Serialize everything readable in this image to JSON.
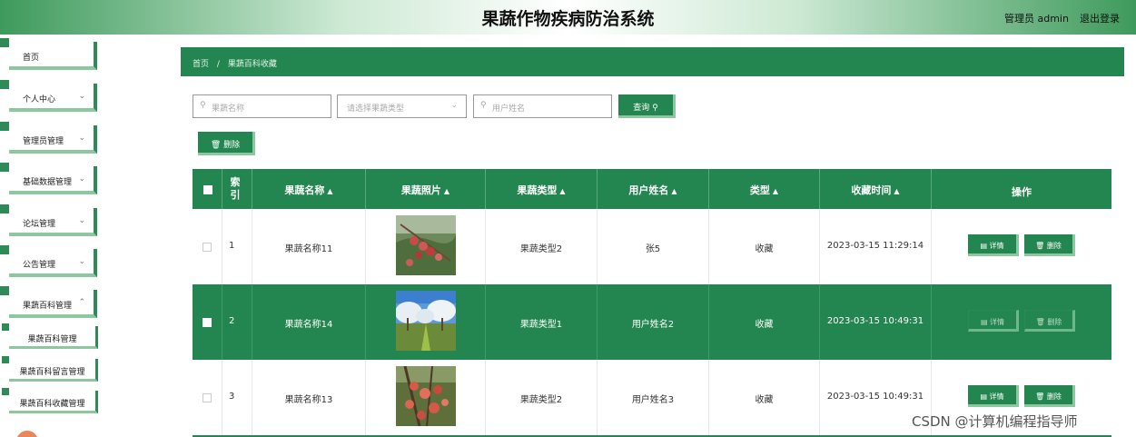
{
  "header": {
    "title": "果蔬作物疾病防治系统",
    "user": "管理员 admin",
    "logout": "退出登录"
  },
  "sidebar": {
    "items": [
      {
        "label": "首页",
        "has_chevron": false
      },
      {
        "label": "个人中心",
        "has_chevron": true
      },
      {
        "label": "管理员管理",
        "has_chevron": true
      },
      {
        "label": "基础数据管理",
        "has_chevron": true
      },
      {
        "label": "论坛管理",
        "has_chevron": true
      },
      {
        "label": "公告管理",
        "has_chevron": true
      },
      {
        "label": "果蔬百科管理",
        "has_chevron": true
      }
    ],
    "subitems": [
      {
        "label": "果蔬百科管理"
      },
      {
        "label": "果蔬百科留言管理"
      },
      {
        "label": "果蔬百科收藏管理"
      }
    ]
  },
  "breadcrumb": {
    "home": "首页",
    "separator": "/",
    "current": "果蔬百科收藏"
  },
  "search": {
    "name_placeholder": "果蔬名称",
    "type_placeholder": "请选择果蔬类型",
    "user_placeholder": "用户姓名",
    "query_label": "查询",
    "delete_label": "删除"
  },
  "table": {
    "headers": {
      "index": "索引",
      "name": "果蔬名称",
      "photo": "果蔬照片",
      "type": "果蔬类型",
      "user": "用户姓名",
      "kind": "类型",
      "time": "收藏时间",
      "action": "操作"
    },
    "rows": [
      {
        "index": "1",
        "name": "果蔬名称11",
        "type": "果蔬类型2",
        "user": "张5",
        "kind": "收藏",
        "time": "2023-03-15 11:29:14",
        "detail": "详情",
        "delete": "删除",
        "photo": "red-berries"
      },
      {
        "index": "2",
        "name": "果蔬名称14",
        "type": "果蔬类型1",
        "user": "用户姓名2",
        "kind": "收藏",
        "time": "2023-03-15 10:49:31",
        "detail": "详情",
        "delete": "删除",
        "photo": "orchard-blossom"
      },
      {
        "index": "3",
        "name": "果蔬名称13",
        "type": "果蔬类型2",
        "user": "用户姓名3",
        "kind": "收藏",
        "time": "2023-03-15 10:49:31",
        "detail": "详情",
        "delete": "删除",
        "photo": "apple-tree"
      }
    ]
  },
  "watermark": "CSDN @计算机编程指导师",
  "colors": {
    "primary": "#238650",
    "accent_light": "#8cc7a0"
  }
}
